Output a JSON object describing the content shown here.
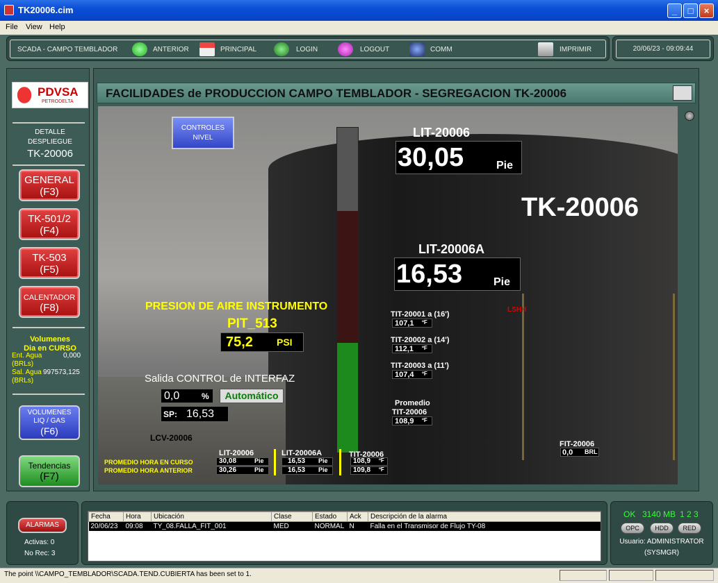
{
  "window": {
    "title": "TK20006.cim"
  },
  "menu": [
    "File",
    "View",
    "Help"
  ],
  "toolbar": {
    "app_label": "SCADA - CAMPO TEMBLADOR",
    "anterior": "ANTERIOR",
    "principal": "PRINCIPAL",
    "login": "LOGIN",
    "logout": "LOGOUT",
    "comm": "COMM",
    "imprimir": "IMPRIMIR",
    "datetime": "20/06/23 - 09:09:44"
  },
  "sidebar": {
    "logo_main": "PDVSA",
    "logo_sub": "PETRODELTA",
    "detalle_1": "DETALLE",
    "detalle_2": "DESPLIEGUE",
    "detalle_tk": "TK-20006",
    "buttons": [
      {
        "l1": "GENERAL",
        "l2": "(F3)"
      },
      {
        "l1": "TK-501/2",
        "l2": "(F4)"
      },
      {
        "l1": "TK-503",
        "l2": "(F5)"
      },
      {
        "l1": "CALENTADOR",
        "l2": "(F8)"
      }
    ],
    "volumenes_1": "Volumenes",
    "volumenes_2": "Dia en CURSO",
    "ent_label": "Ent. Agua",
    "ent_value": "0,000",
    "ent_unit": "(BRLs)",
    "sal_label": "Sal. Agua",
    "sal_value": "997573,125",
    "sal_unit": "(BRLs)",
    "vol_btn_1": "VOLUMENES",
    "vol_btn_2": "LIQ / GAS",
    "vol_btn_3": "(F6)",
    "tend_btn_1": "Tendencias",
    "tend_btn_2": "(F7)"
  },
  "header": {
    "title": "FACILIDADES de PRODUCCION CAMPO TEMBLADOR - SEGREGACION TK-20006"
  },
  "scene": {
    "controles_1": "CONTROLES",
    "controles_2": "NIVEL",
    "lit1_label": "LIT-20006",
    "lit1_value": "30,05",
    "lit1_unit": "Pie",
    "tank_label": "TK-20006",
    "lit2_label": "LIT-20006A",
    "lit2_value": "16,53",
    "lit2_unit": "Pie",
    "level_fraction": 0.55,
    "presion_title": "PRESION DE AIRE INSTRUMENTO",
    "pit_label": "PIT_513",
    "pit_value": "75,2",
    "pit_unit": "PSI",
    "salida_label": "Salida CONTROL de INTERFAZ",
    "salida_value": "0,0",
    "salida_unit": "%",
    "auto_label": "Automático",
    "sp_label": "SP:",
    "sp_value": "16,53",
    "lcv_label": "LCV-20006",
    "lshh": "LSHH",
    "tit1_label": "TIT-20001 a (16')",
    "tit1_value": "107,1",
    "tit2_label": "TIT-20002 a (14')",
    "tit2_value": "112,1",
    "tit3_label": "TIT-20003 a (11')",
    "tit3_value": "107,4",
    "temp_unit": "ºF",
    "prom_1": "Promedio",
    "prom_2": "TIT-20006",
    "prom_value": "108,9",
    "fit_label": "FIT-20006",
    "fit_value": "0,0",
    "fit_unit": "BRL",
    "prom_curso": "PROMEDIO HORA EN CURSO",
    "prom_anterior": "PROMEDIO HORA ANTERIOR",
    "col1_label": "LIT-20006",
    "col1_v1": "30,08",
    "col1_v2": "30,26",
    "col2_label": "LIT-20006A",
    "col2_v1": "16,53",
    "col2_v2": "16,53",
    "col3_label": "TIT-20006",
    "col3_v1": "108,9",
    "col3_v2": "109,8",
    "pie": "Pie",
    "degf": "ºF"
  },
  "alarms": {
    "button": "ALARMAS",
    "activas": "Activas: 0",
    "norec": "No Rec: 3",
    "columns": [
      "Fecha",
      "Hora",
      "Ubicación",
      "Clase",
      "Estado",
      "Ack",
      "Descripción de la alarma"
    ],
    "rows": [
      [
        "20/06/23",
        "09:08",
        "TY_08.FALLA_FIT_001",
        "MED",
        "NORMAL",
        "N",
        "Falla en el Transmisor de Flujo TY-08"
      ]
    ]
  },
  "status": {
    "ok": "OK",
    "mem": "3140 MB",
    "nums": "1 2 3",
    "opc": "OPC",
    "hdd": "HDD",
    "red": "RED",
    "user_1": "Usuario: ADMINISTRATOR",
    "user_2": "(SYSMGR)"
  },
  "statusbar": {
    "text": "The point \\\\CAMPO_TEMBLADOR\\SCADA.TEND.CUBIERTA has been set to 1."
  }
}
